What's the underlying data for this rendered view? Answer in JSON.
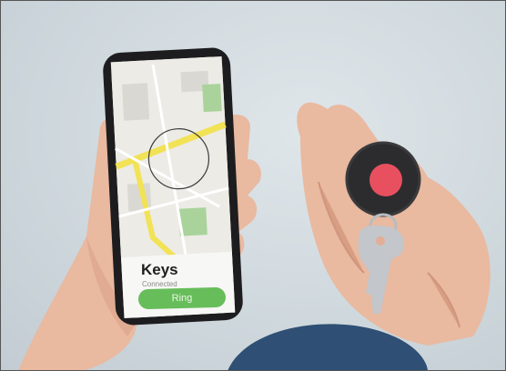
{
  "tracker_app": {
    "item_name": "Keys",
    "status": "Connected",
    "action_label": "Ring"
  }
}
